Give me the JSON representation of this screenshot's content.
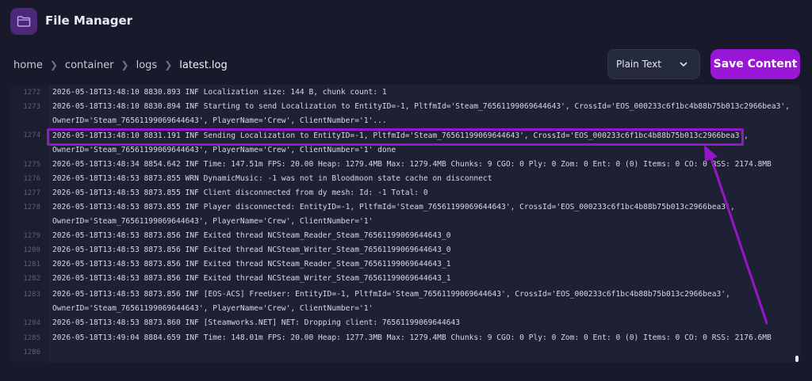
{
  "app": {
    "title": "File Manager",
    "icon": "folder-icon",
    "accent": "#9a16d6"
  },
  "breadcrumb": [
    "home",
    "container",
    "logs",
    "latest.log"
  ],
  "toolbar": {
    "format_selected": "Plain Text",
    "save_label": "Save Content"
  },
  "editor": {
    "line_numbers": [
      "1272",
      "1273",
      "1274",
      "1275",
      "1276",
      "1277",
      "1278",
      "1279",
      "1280",
      "1281",
      "1282",
      "1283",
      "1284",
      "1285",
      "1286"
    ],
    "lines": [
      "2026-05-18T13:48:10 8830.893 INF Localization size: 144 B, chunk count: 1",
      "2026-05-18T13:48:10 8830.894 INF Starting to send Localization to EntityID=-1, PltfmId='Steam_76561199069644643', CrossId='EOS_000233c6f1bc4b88b75b013c2966bea3',",
      "OwnerID='Steam_76561199069644643', PlayerName='Crew', ClientNumber='1'...",
      "2026-05-18T13:48:10 8831.191 INF Sending Localization to EntityID=-1, PltfmId='Steam_76561199069644643', CrossId='EOS_000233c6f1bc4b88b75b013c2966bea3',",
      "OwnerID='Steam_76561199069644643', PlayerName='Crew', ClientNumber='1' done",
      "2026-05-18T13:48:34 8854.642 INF Time: 147.51m FPS: 20.00 Heap: 1279.4MB Max: 1279.4MB Chunks: 9 CGO: 0 Ply: 0 Zom: 0 Ent: 0 (0) Items: 0 CO: 0 RSS: 2174.8MB",
      "2026-05-18T13:48:53 8873.855 WRN DynamicMusic: -1 was not in Bloodmoon state cache on disconnect",
      "2026-05-18T13:48:53 8873.855 INF Client disconnected from dy mesh: Id: -1 Total: 0",
      "2026-05-18T13:48:53 8873.855 INF Player disconnected: EntityID=-1, PltfmId='Steam_76561199069644643', CrossId='EOS_000233c6f1bc4b88b75b013c2966bea3',",
      "OwnerID='Steam_76561199069644643', PlayerName='Crew', ClientNumber='1'",
      "2026-05-18T13:48:53 8873.856 INF Exited thread NCSteam_Reader_Steam_76561199069644643_0",
      "2026-05-18T13:48:53 8873.856 INF Exited thread NCSteam_Writer_Steam_76561199069644643_0",
      "2026-05-18T13:48:53 8873.856 INF Exited thread NCSteam_Reader_Steam_76561199069644643_1",
      "2026-05-18T13:48:53 8873.856 INF Exited thread NCSteam_Writer_Steam_76561199069644643_1",
      "2026-05-18T13:48:53 8873.856 INF [EOS-ACS] FreeUser: EntityID=-1, PltfmId='Steam_76561199069644643', CrossId='EOS_000233c6f1bc4b88b75b013c2966bea3',",
      "OwnerID='Steam_76561199069644643', PlayerName='Crew', ClientNumber='1'",
      "2026-05-18T13:48:53 8873.860 INF [Steamworks.NET] NET: Dropping client: 76561199069644643",
      "2026-05-18T13:49:04 8884.659 INF Time: 148.01m FPS: 20.00 Heap: 1277.3MB Max: 1279.4MB Chunks: 9 CGO: 0 Ply: 0 Zom: 0 Ent: 0 (0) Items: 0 CO: 0 RSS: 2176.6MB"
    ]
  },
  "annotation_color": "#9316c8"
}
